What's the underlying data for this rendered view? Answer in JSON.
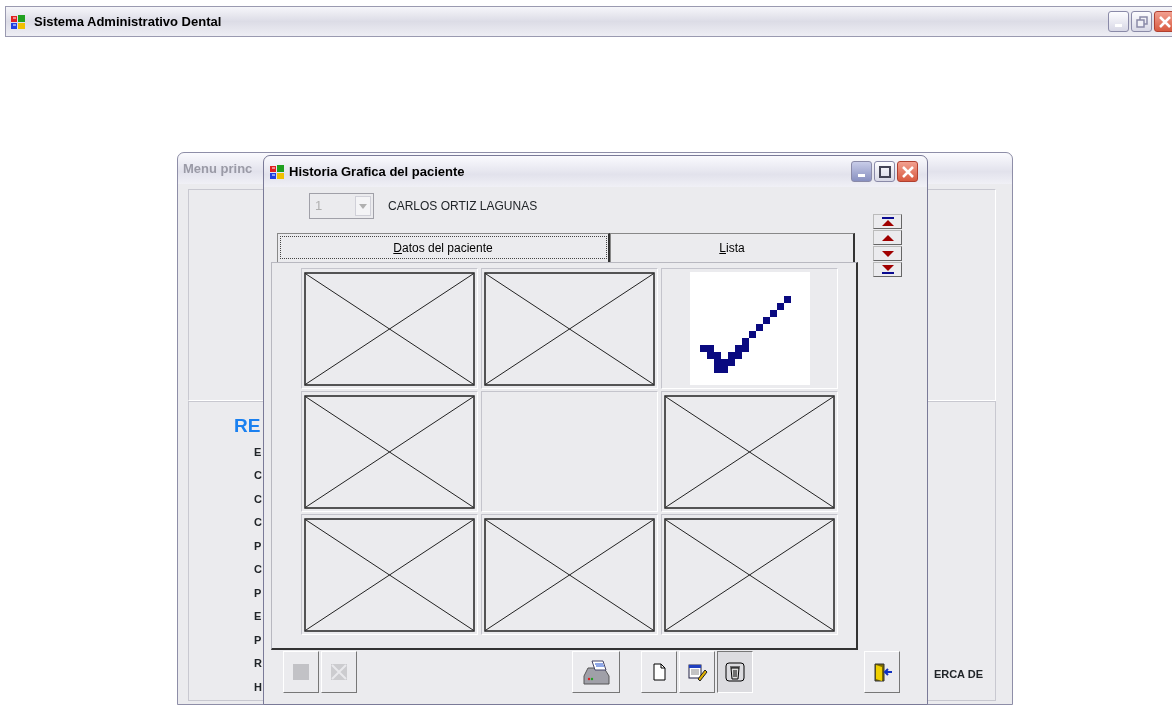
{
  "main_window": {
    "title": "Sistema Administrativo Dental",
    "controls": [
      {
        "kind": "minimize"
      },
      {
        "kind": "restore"
      },
      {
        "kind": "close"
      }
    ]
  },
  "menu_window": {
    "title": "Menu princ",
    "heading": "RE",
    "items": [
      "E",
      "C",
      "C",
      "C",
      "P",
      "C",
      "P",
      "E",
      "P",
      "R",
      "H"
    ],
    "side_label": "ERCA DE"
  },
  "history_window": {
    "title": "Historia Grafica del paciente",
    "controls": [
      {
        "kind": "minimize"
      },
      {
        "kind": "maximize"
      },
      {
        "kind": "close"
      }
    ],
    "patient_select": {
      "value": "1",
      "disabled": true
    },
    "patient_name": "CARLOS ORTIZ LAGUNAS",
    "tabs": [
      {
        "label": "Datos del paciente",
        "selected": true
      },
      {
        "label": "Lista",
        "selected": false
      }
    ],
    "images": [
      {
        "kind": "broken"
      },
      {
        "kind": "broken"
      },
      {
        "kind": "check"
      },
      {
        "kind": "broken"
      },
      {
        "kind": "empty"
      },
      {
        "kind": "broken"
      },
      {
        "kind": "broken"
      },
      {
        "kind": "broken"
      },
      {
        "kind": "broken"
      }
    ],
    "navigation": [
      {
        "kind": "first"
      },
      {
        "kind": "previous"
      },
      {
        "kind": "next"
      },
      {
        "kind": "last"
      }
    ],
    "toolbar": [
      {
        "kind": "stop",
        "disabled": true,
        "pressed": false
      },
      {
        "kind": "cancel",
        "disabled": true,
        "pressed": false
      },
      {
        "kind": "print",
        "disabled": false,
        "pressed": false
      },
      {
        "kind": "new",
        "disabled": false,
        "pressed": false
      },
      {
        "kind": "edit",
        "disabled": false,
        "pressed": false
      },
      {
        "kind": "delete",
        "disabled": false,
        "pressed": true
      },
      {
        "kind": "exit",
        "disabled": false,
        "pressed": false
      }
    ]
  }
}
